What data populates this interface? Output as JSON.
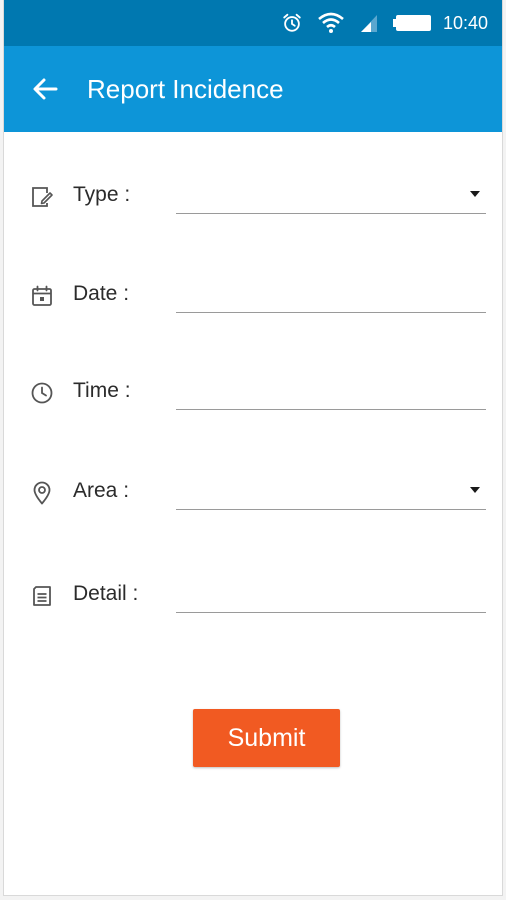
{
  "status_bar": {
    "icons": [
      "alarm-icon",
      "wifi-icon",
      "signal-icon",
      "battery-icon"
    ],
    "time": "10:40"
  },
  "app_bar": {
    "back_icon": "arrow-left-icon",
    "title": "Report Incidence"
  },
  "form": {
    "fields": [
      {
        "id": "type",
        "icon": "edit-document-icon",
        "label": "Type :",
        "value": "",
        "kind": "dropdown"
      },
      {
        "id": "date",
        "icon": "calendar-icon",
        "label": "Date :",
        "value": "",
        "kind": "text"
      },
      {
        "id": "time",
        "icon": "clock-icon",
        "label": "Time :",
        "value": "",
        "kind": "text"
      },
      {
        "id": "area",
        "icon": "location-pin-icon",
        "label": "Area :",
        "value": "",
        "kind": "dropdown"
      },
      {
        "id": "detail",
        "icon": "notes-icon",
        "label": "Detail :",
        "value": "",
        "kind": "text"
      }
    ],
    "submit_label": "Submit"
  },
  "colors": {
    "status_bar": "#0078b0",
    "app_bar": "#0d95d8",
    "submit_button": "#f15a22",
    "underline": "#9a9a9a"
  }
}
